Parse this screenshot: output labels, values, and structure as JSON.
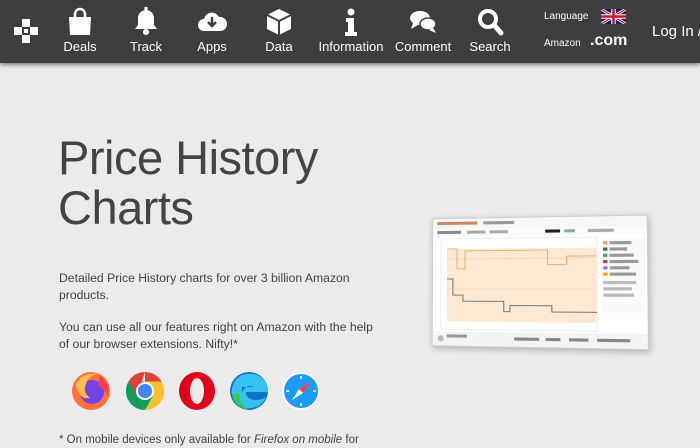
{
  "nav": {
    "items": [
      {
        "label": "Deals",
        "icon": "shopping-bag-icon"
      },
      {
        "label": "Track",
        "icon": "bell-icon"
      },
      {
        "label": "Apps",
        "icon": "cloud-download-icon"
      },
      {
        "label": "Data",
        "icon": "box-icon"
      },
      {
        "label": "Information",
        "icon": "info-icon"
      },
      {
        "label": "Comment",
        "icon": "speech-bubbles-icon"
      },
      {
        "label": "Search",
        "icon": "magnifier-icon"
      }
    ],
    "language_label": "Language",
    "amazon_label": "Amazon",
    "amazon_domain": ".com",
    "login_label": "Log In /"
  },
  "hero": {
    "title_line1": "Price History",
    "title_line2": "Charts",
    "paragraph1": "Detailed Price History charts for over 3 billion Amazon products.",
    "paragraph2": "You can use all our features right on Amazon with the help of our browser extensions. Nifty!*",
    "note_prefix": "* On mobile devices only available for ",
    "note_link": "Firefox on mobile",
    "note_suffix": " for"
  },
  "browsers": [
    "firefox-icon",
    "chrome-icon",
    "opera-icon",
    "edge-icon",
    "safari-icon"
  ],
  "colors": {
    "topbar": "#3e3e3e",
    "page_bg": "#ebebeb",
    "text": "#444444"
  }
}
